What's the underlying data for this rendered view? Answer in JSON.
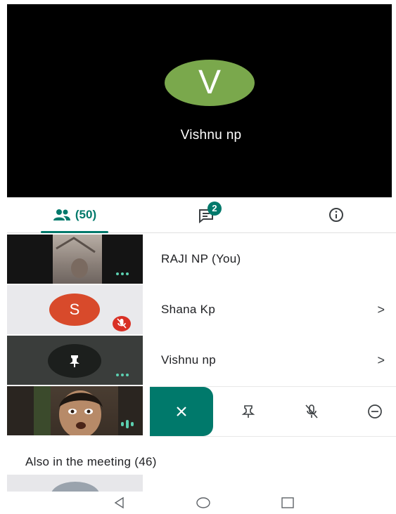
{
  "stage": {
    "top_text": "",
    "avatar_letter": "V",
    "name": "Vishnu np"
  },
  "tabs": {
    "people_label": "(50)",
    "chat_badge": "2"
  },
  "participants": [
    {
      "name": "RAJI NP (You)"
    },
    {
      "name": "Shana Kp",
      "avatar_letter": "S",
      "chevron": ">"
    },
    {
      "name": "Vishnu np",
      "chevron": ">"
    }
  ],
  "section": {
    "title": "Also in the meeting (46)"
  },
  "colors": {
    "accent": "#00796b",
    "stage_avatar": "#7aa84c",
    "shana_avatar": "#d84a2b",
    "mute_red": "#d93025"
  },
  "icons": [
    "people-icon",
    "chat-icon",
    "info-icon",
    "pin-icon",
    "mic-off-icon",
    "remove-icon",
    "close-icon",
    "chevron-right-icon"
  ]
}
